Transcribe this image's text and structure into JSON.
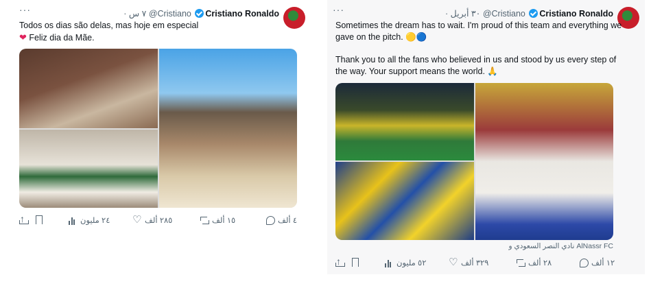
{
  "colors": {
    "verified": "#1d9bf0",
    "heart": "#e0245e",
    "meta": "#536471"
  },
  "tweets": [
    {
      "author_name": "Cristiano Ronaldo",
      "handle": "@Cristiano",
      "time": "· ٧ س",
      "more": "···",
      "text_line1": "Todos os dias são delas, mas hoje em especial",
      "text_line2": "Feliz dia da Mãe.",
      "heart_icon": "red-heart-emoji",
      "replies": "٤ ألف",
      "retweets": "١٥ ألف",
      "likes": "٢٨٥ ألف",
      "views": "٢٤ مليون"
    },
    {
      "author_name": "Cristiano Ronaldo",
      "handle": "@Cristiano",
      "time": "· ٣٠ أبريل",
      "more": "···",
      "text_line1": "Sometimes the dream has to wait. I'm proud of this team and everything we",
      "text_line2": "gave on the pitch. 🟡🔵",
      "text_line3": "Thank you to all the fans who believed in us and stood by us every step of",
      "text_line4": "the way. Your support means the world. 🙏",
      "source": "نادي النصر السعودي و AlNassr FC",
      "replies": "١٢ ألف",
      "retweets": "٢٨ ألف",
      "likes": "٣٢٩ ألف",
      "views": "٥٢ مليون"
    }
  ]
}
